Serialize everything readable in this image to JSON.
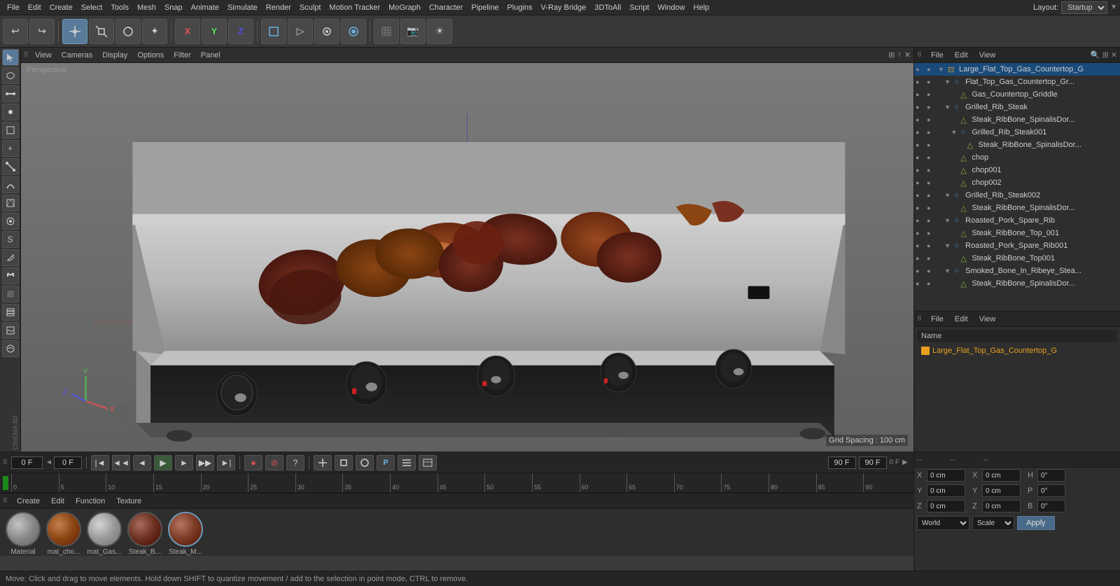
{
  "app": {
    "title": "Cinema 4D",
    "layout_label": "Layout:",
    "layout_value": "Startup"
  },
  "menu": {
    "items": [
      "File",
      "Edit",
      "Create",
      "Select",
      "Tools",
      "Mesh",
      "Snap",
      "Animate",
      "Simulate",
      "Render",
      "Sculpt",
      "Motion Tracker",
      "MoGraph",
      "Character",
      "Pipeline",
      "Plugins",
      "V-Ray Bridge",
      "3DToAll",
      "Script",
      "Window",
      "Help"
    ]
  },
  "toolbar": {
    "undo_icon": "↩",
    "redo_icon": "↪",
    "tools": [
      "⊕",
      "↔",
      "↻",
      "✦",
      "X",
      "Y",
      "Z",
      "□",
      "▷",
      "⊕",
      "●",
      "◎",
      "⬡",
      "⊞",
      "☼",
      "◉",
      "△",
      "⬟",
      "⊘",
      "📷"
    ]
  },
  "viewport": {
    "menus": [
      "View",
      "Cameras",
      "Display",
      "Options",
      "Filter",
      "Panel"
    ],
    "label": "Perspective",
    "grid_spacing": "Grid Spacing : 100 cm"
  },
  "scene_tree": {
    "items": [
      {
        "id": 1,
        "level": 0,
        "name": "Large_Flat_Top_Gas_Countertop_G",
        "type": "object",
        "has_children": true,
        "visibility": "on"
      },
      {
        "id": 2,
        "level": 1,
        "name": "Flat_Top_Gas_Countertop_Gr...",
        "type": "null",
        "has_children": true,
        "visibility": "on"
      },
      {
        "id": 3,
        "level": 2,
        "name": "Gas_Countertop_Griddle",
        "type": "mesh",
        "has_children": false,
        "visibility": "on"
      },
      {
        "id": 4,
        "level": 1,
        "name": "Grilled_Rib_Steak",
        "type": "null",
        "has_children": true,
        "visibility": "on"
      },
      {
        "id": 5,
        "level": 2,
        "name": "Steak_RibBone_SpinalisDor...",
        "type": "mesh",
        "has_children": false,
        "visibility": "on"
      },
      {
        "id": 6,
        "level": 2,
        "name": "Grilled_Rib_Steak001",
        "type": "null",
        "has_children": true,
        "visibility": "on"
      },
      {
        "id": 7,
        "level": 3,
        "name": "Steak_RibBone_SpinalisDor...",
        "type": "mesh",
        "has_children": false,
        "visibility": "on"
      },
      {
        "id": 8,
        "level": 2,
        "name": "chop",
        "type": "mesh",
        "has_children": false,
        "visibility": "on"
      },
      {
        "id": 9,
        "level": 2,
        "name": "chop001",
        "type": "mesh",
        "has_children": false,
        "visibility": "on"
      },
      {
        "id": 10,
        "level": 2,
        "name": "chop002",
        "type": "mesh",
        "has_children": false,
        "visibility": "on"
      },
      {
        "id": 11,
        "level": 1,
        "name": "Grilled_Rib_Steak002",
        "type": "null",
        "has_children": true,
        "visibility": "on"
      },
      {
        "id": 12,
        "level": 2,
        "name": "Steak_RibBone_SpinalisDor...",
        "type": "mesh",
        "has_children": false,
        "visibility": "on"
      },
      {
        "id": 13,
        "level": 1,
        "name": "Roasted_Pork_Spare_Rib",
        "type": "null",
        "has_children": true,
        "visibility": "on"
      },
      {
        "id": 14,
        "level": 2,
        "name": "Steak_RibBone_Top_001",
        "type": "mesh",
        "has_children": false,
        "visibility": "on"
      },
      {
        "id": 15,
        "level": 1,
        "name": "Roasted_Pork_Spare_Rib001",
        "type": "null",
        "has_children": true,
        "visibility": "on"
      },
      {
        "id": 16,
        "level": 2,
        "name": "Steak_RibBone_Top001",
        "type": "mesh",
        "has_children": false,
        "visibility": "on"
      },
      {
        "id": 17,
        "level": 1,
        "name": "Smoked_Bone_In_Ribeye_Stea...",
        "type": "null",
        "has_children": true,
        "visibility": "on"
      },
      {
        "id": 18,
        "level": 2,
        "name": "Steak_RibBone_SpinalisDor...",
        "type": "mesh",
        "has_children": false,
        "visibility": "on"
      }
    ]
  },
  "attributes_panel": {
    "header_menus": [
      "File",
      "Edit",
      "View"
    ],
    "name_label": "Name",
    "name_value": "Large_Flat_Top_Gas_Countertop_G",
    "name_color": "#e8a020"
  },
  "timeline": {
    "start_frame": "0 F",
    "end_frame": "90 F",
    "current_frame": "0 F",
    "preview_start": "0 F",
    "preview_end": "90 F",
    "frame_markers": [
      "0",
      "5",
      "10",
      "15",
      "20",
      "25",
      "30",
      "35",
      "40",
      "45",
      "50",
      "55",
      "60",
      "65",
      "70",
      "75",
      "80",
      "85",
      "90"
    ]
  },
  "materials": {
    "header_menus": [
      "Create",
      "Edit",
      "Function",
      "Texture"
    ],
    "items": [
      {
        "name": "Material",
        "color": "#888888"
      },
      {
        "name": "mat_cho...",
        "color": "#8B4513"
      },
      {
        "name": "mat_Gas...",
        "color": "#999999"
      },
      {
        "name": "Steak_B...",
        "color": "#6B3020"
      },
      {
        "name": "Steak_M...",
        "color": "#7B3a25",
        "selected": true
      }
    ]
  },
  "coordinates": {
    "x": {
      "pos": "0 cm",
      "size": "0 cm",
      "h": "0°"
    },
    "y": {
      "pos": "0 cm",
      "size": "0 cm",
      "p": "0°"
    },
    "z": {
      "pos": "0 cm",
      "size": "0 cm",
      "b": "0°"
    },
    "world_label": "World",
    "scale_label": "Scale",
    "apply_label": "Apply"
  },
  "status_bar": {
    "text": "Move: Click and drag to move elements. Hold down SHIFT to quantize movement / add to the selection in point mode, CTRL to remove."
  },
  "maxon_logo": "MAXON CINEMA 4D"
}
